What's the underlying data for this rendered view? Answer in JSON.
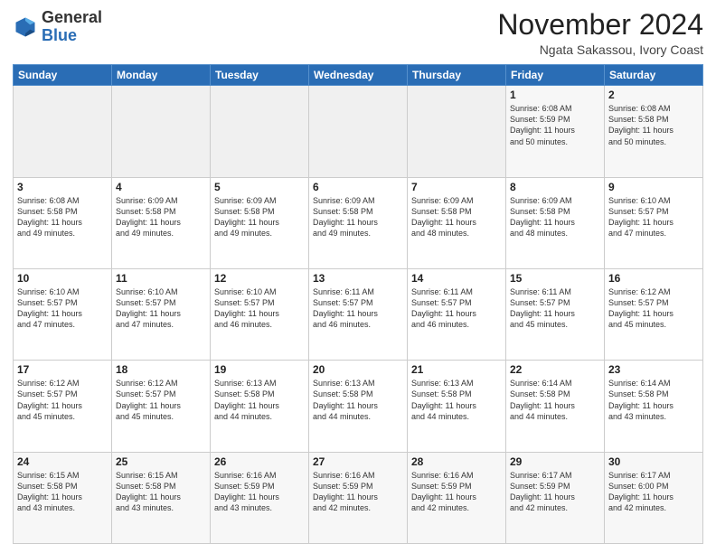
{
  "header": {
    "logo_general": "General",
    "logo_blue": "Blue",
    "month": "November 2024",
    "location": "Ngata Sakassou, Ivory Coast"
  },
  "weekdays": [
    "Sunday",
    "Monday",
    "Tuesday",
    "Wednesday",
    "Thursday",
    "Friday",
    "Saturday"
  ],
  "weeks": [
    [
      {
        "day": "",
        "info": "",
        "empty": true
      },
      {
        "day": "",
        "info": "",
        "empty": true
      },
      {
        "day": "",
        "info": "",
        "empty": true
      },
      {
        "day": "",
        "info": "",
        "empty": true
      },
      {
        "day": "",
        "info": "",
        "empty": true
      },
      {
        "day": "1",
        "info": "Sunrise: 6:08 AM\nSunset: 5:59 PM\nDaylight: 11 hours\nand 50 minutes."
      },
      {
        "day": "2",
        "info": "Sunrise: 6:08 AM\nSunset: 5:58 PM\nDaylight: 11 hours\nand 50 minutes."
      }
    ],
    [
      {
        "day": "3",
        "info": "Sunrise: 6:08 AM\nSunset: 5:58 PM\nDaylight: 11 hours\nand 49 minutes."
      },
      {
        "day": "4",
        "info": "Sunrise: 6:09 AM\nSunset: 5:58 PM\nDaylight: 11 hours\nand 49 minutes."
      },
      {
        "day": "5",
        "info": "Sunrise: 6:09 AM\nSunset: 5:58 PM\nDaylight: 11 hours\nand 49 minutes."
      },
      {
        "day": "6",
        "info": "Sunrise: 6:09 AM\nSunset: 5:58 PM\nDaylight: 11 hours\nand 49 minutes."
      },
      {
        "day": "7",
        "info": "Sunrise: 6:09 AM\nSunset: 5:58 PM\nDaylight: 11 hours\nand 48 minutes."
      },
      {
        "day": "8",
        "info": "Sunrise: 6:09 AM\nSunset: 5:58 PM\nDaylight: 11 hours\nand 48 minutes."
      },
      {
        "day": "9",
        "info": "Sunrise: 6:10 AM\nSunset: 5:57 PM\nDaylight: 11 hours\nand 47 minutes."
      }
    ],
    [
      {
        "day": "10",
        "info": "Sunrise: 6:10 AM\nSunset: 5:57 PM\nDaylight: 11 hours\nand 47 minutes."
      },
      {
        "day": "11",
        "info": "Sunrise: 6:10 AM\nSunset: 5:57 PM\nDaylight: 11 hours\nand 47 minutes."
      },
      {
        "day": "12",
        "info": "Sunrise: 6:10 AM\nSunset: 5:57 PM\nDaylight: 11 hours\nand 46 minutes."
      },
      {
        "day": "13",
        "info": "Sunrise: 6:11 AM\nSunset: 5:57 PM\nDaylight: 11 hours\nand 46 minutes."
      },
      {
        "day": "14",
        "info": "Sunrise: 6:11 AM\nSunset: 5:57 PM\nDaylight: 11 hours\nand 46 minutes."
      },
      {
        "day": "15",
        "info": "Sunrise: 6:11 AM\nSunset: 5:57 PM\nDaylight: 11 hours\nand 45 minutes."
      },
      {
        "day": "16",
        "info": "Sunrise: 6:12 AM\nSunset: 5:57 PM\nDaylight: 11 hours\nand 45 minutes."
      }
    ],
    [
      {
        "day": "17",
        "info": "Sunrise: 6:12 AM\nSunset: 5:57 PM\nDaylight: 11 hours\nand 45 minutes."
      },
      {
        "day": "18",
        "info": "Sunrise: 6:12 AM\nSunset: 5:57 PM\nDaylight: 11 hours\nand 45 minutes."
      },
      {
        "day": "19",
        "info": "Sunrise: 6:13 AM\nSunset: 5:58 PM\nDaylight: 11 hours\nand 44 minutes."
      },
      {
        "day": "20",
        "info": "Sunrise: 6:13 AM\nSunset: 5:58 PM\nDaylight: 11 hours\nand 44 minutes."
      },
      {
        "day": "21",
        "info": "Sunrise: 6:13 AM\nSunset: 5:58 PM\nDaylight: 11 hours\nand 44 minutes."
      },
      {
        "day": "22",
        "info": "Sunrise: 6:14 AM\nSunset: 5:58 PM\nDaylight: 11 hours\nand 44 minutes."
      },
      {
        "day": "23",
        "info": "Sunrise: 6:14 AM\nSunset: 5:58 PM\nDaylight: 11 hours\nand 43 minutes."
      }
    ],
    [
      {
        "day": "24",
        "info": "Sunrise: 6:15 AM\nSunset: 5:58 PM\nDaylight: 11 hours\nand 43 minutes."
      },
      {
        "day": "25",
        "info": "Sunrise: 6:15 AM\nSunset: 5:58 PM\nDaylight: 11 hours\nand 43 minutes."
      },
      {
        "day": "26",
        "info": "Sunrise: 6:16 AM\nSunset: 5:59 PM\nDaylight: 11 hours\nand 43 minutes."
      },
      {
        "day": "27",
        "info": "Sunrise: 6:16 AM\nSunset: 5:59 PM\nDaylight: 11 hours\nand 42 minutes."
      },
      {
        "day": "28",
        "info": "Sunrise: 6:16 AM\nSunset: 5:59 PM\nDaylight: 11 hours\nand 42 minutes."
      },
      {
        "day": "29",
        "info": "Sunrise: 6:17 AM\nSunset: 5:59 PM\nDaylight: 11 hours\nand 42 minutes."
      },
      {
        "day": "30",
        "info": "Sunrise: 6:17 AM\nSunset: 6:00 PM\nDaylight: 11 hours\nand 42 minutes."
      }
    ]
  ]
}
